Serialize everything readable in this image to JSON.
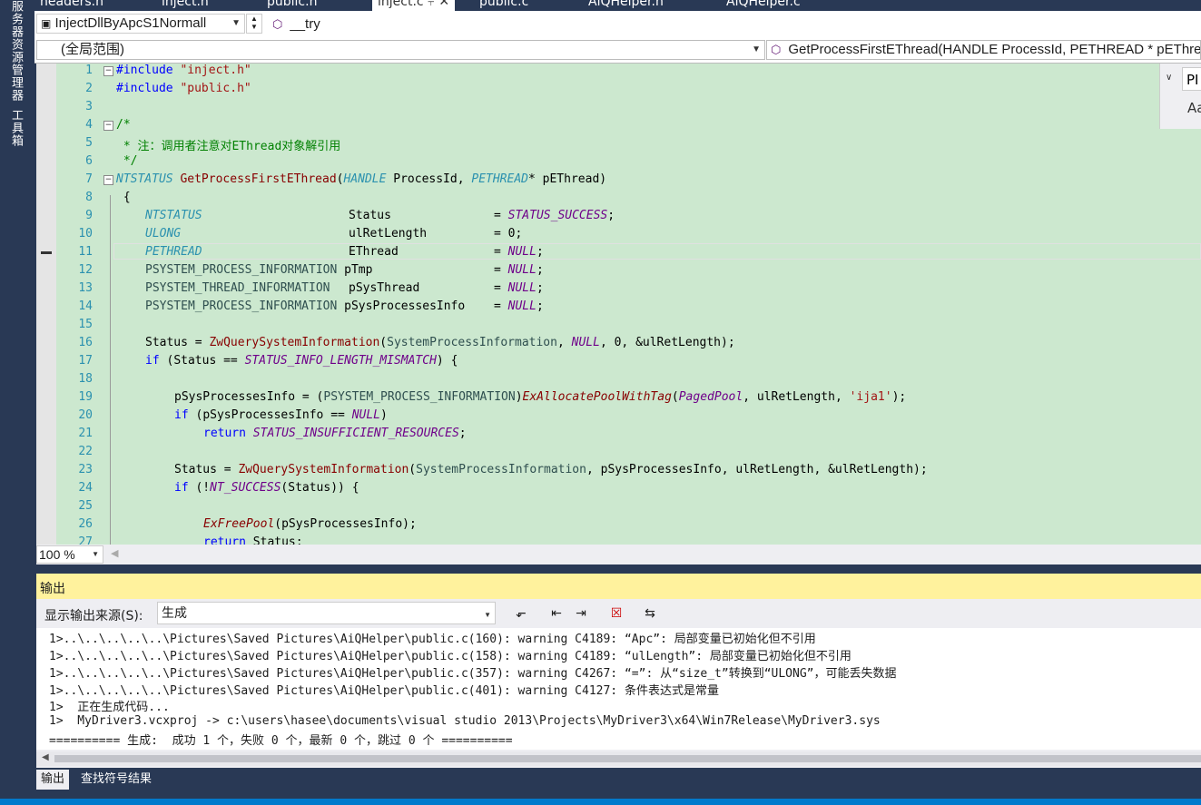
{
  "tabs": [
    "headers.h",
    "inject.h",
    "public.h",
    "inject.c",
    "public.c",
    "AiQHelper.h",
    "AiQHelper.c"
  ],
  "side_tabs": [
    "服务器资源管理器",
    "工具箱"
  ],
  "nav": {
    "project": "InjectDllByApcS1Normall",
    "member": "__try",
    "scope": "(全局范围)",
    "function": "GetProcessFirstEThread(HANDLE ProcessId, PETHREAD * pEThread)",
    "find_box": "PI",
    "find_opt": "Aa"
  },
  "line_numbers": [
    "1",
    "2",
    "3",
    "4",
    "5",
    "6",
    "7",
    "8",
    "9",
    "10",
    "11",
    "12",
    "13",
    "14",
    "15",
    "16",
    "17",
    "18",
    "19",
    "20",
    "21",
    "22",
    "23",
    "24",
    "25",
    "26",
    "27"
  ],
  "code": {
    "include_kw": "#include",
    "l1_str": "\"inject.h\"",
    "l2_str": "\"public.h\"",
    "l4": "/*",
    "l5": " * 注：调用者注意对EThread对象解引用",
    "l6": " */",
    "ntstatus": "NTSTATUS",
    "ulong": "ULONG",
    "pethread": "PETHREAD",
    "handle": "HANDLE",
    "func_name": "GetProcessFirstEThread",
    "p_pid": "ProcessId",
    "p_peth": "pEThread",
    "lbrace": "{",
    "v_status": "Status",
    "v_ul": "ulRetLength",
    "v_ethread": "EThread",
    "v_ptmp": "pTmp",
    "v_psys": "pSysThread",
    "v_pspi": "pSysProcessesInfo",
    "t_proc": "PSYSTEM_PROCESS_INFORMATION",
    "t_thread": "PSYSTEM_THREAD_INFORMATION",
    "status_success": "STATUS_SUCCESS",
    "null": "NULL",
    "zero": "0",
    "zwq": "ZwQuerySystemInformation",
    "spi": "SystemProcessInformation",
    "kw_if": "if",
    "kw_return": "return",
    "mismatch": "STATUS_INFO_LENGTH_MISMATCH",
    "exalloc": "ExAllocatePoolWithTag",
    "paged": "PagedPool",
    "tag": "'ija1'",
    "insuff": "STATUS_INSUFFICIENT_RESOURCES",
    "ntsuccess": "NT_SUCCESS",
    "exfree": "ExFreePool"
  },
  "zoom": "100 %",
  "output": {
    "title": "输出",
    "source_label": "显示输出来源(S):",
    "source_value": "生成",
    "lines": [
      "1>..\\..\\..\\..\\..\\Pictures\\Saved Pictures\\AiQHelper\\public.c(160): warning C4189: “Apc”: 局部变量已初始化但不引用",
      "1>..\\..\\..\\..\\..\\Pictures\\Saved Pictures\\AiQHelper\\public.c(158): warning C4189: “ulLength”: 局部变量已初始化但不引用",
      "1>..\\..\\..\\..\\..\\Pictures\\Saved Pictures\\AiQHelper\\public.c(357): warning C4267: “=”: 从“size_t”转换到“ULONG”，可能丢失数据",
      "1>..\\..\\..\\..\\..\\Pictures\\Saved Pictures\\AiQHelper\\public.c(401): warning C4127: 条件表达式是常量",
      "1>  正在生成代码...",
      "1>  MyDriver3.vcxproj -> c:\\users\\hasee\\documents\\visual studio 2013\\Projects\\MyDriver3\\x64\\Win7Release\\MyDriver3.sys",
      "========== 生成:  成功 1 个，失败 0 个，最新 0 个，跳过 0 个 =========="
    ],
    "tabs": [
      "输出",
      "查找符号结果"
    ]
  },
  "colors": {
    "editor_bg": "#cce8cf",
    "chrome": "#293955",
    "output_header": "#fff29d",
    "statusbar": "#007acc"
  }
}
